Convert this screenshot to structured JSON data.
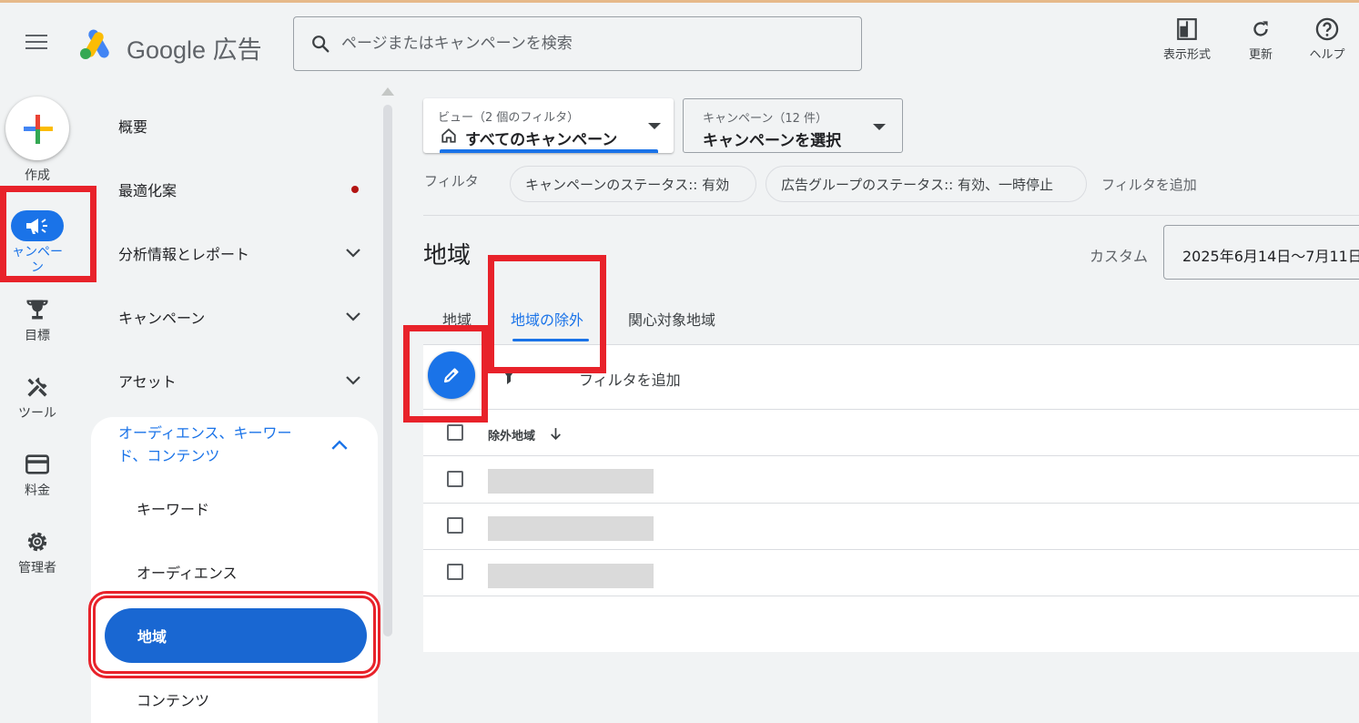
{
  "app": {
    "brand": "Google 広告"
  },
  "search": {
    "placeholder": "ページまたはキャンペーンを検索"
  },
  "header_actions": [
    {
      "label": "表示形式"
    },
    {
      "label": "更新"
    },
    {
      "label": "ヘルプ"
    }
  ],
  "rail": {
    "create": "作成",
    "campaign": "ャンペー",
    "campaign_cut": "ン",
    "goals": "目標",
    "tools": "ツール",
    "billing": "料金",
    "admin": "管理者"
  },
  "nav": {
    "overview": "概要",
    "recommendations": "最適化案",
    "insights": "分析情報とレポート",
    "campaigns": "キャンペーン",
    "assets": "アセット",
    "section_title": "オーディエンス、キーワード、コンテンツ",
    "section_line1": "オーディエンス、キーワー",
    "section_line2": "ド、コンテンツ",
    "keywords": "キーワード",
    "audiences": "オーディエンス",
    "locations": "地域",
    "content": "コンテンツ"
  },
  "filters": {
    "view_small": "ビュー（2 個のフィルタ）",
    "view_value": "すべてのキャンペーン",
    "campaign_small": "キャンペーン（12 件）",
    "campaign_value": "キャンペーンを選択",
    "label": "フィルタ",
    "chips": [
      "キャンペーンのステータス:: 有効",
      "広告グループのステータス:: 有効、一時停止"
    ],
    "add": "フィルタを追加"
  },
  "page": {
    "title": "地域",
    "date_label": "カスタム",
    "date_value": "2025年6月14日〜7月11日"
  },
  "tabs": [
    "地域",
    "地域の除外",
    "関心対象地域"
  ],
  "active_tab": "地域の除外",
  "table": {
    "filter_add": "フィルタを追加",
    "column": "除外地域",
    "rows": 3
  },
  "colors": {
    "accent": "#1a73e8",
    "highlight": "#e8222a"
  }
}
